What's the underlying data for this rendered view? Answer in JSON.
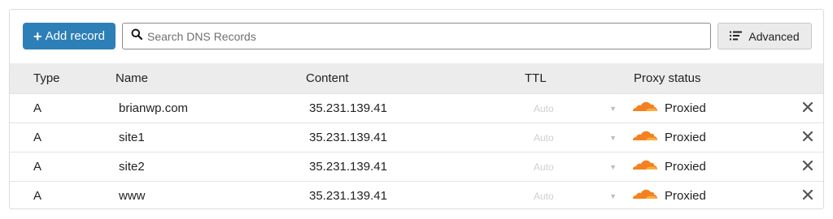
{
  "toolbar": {
    "add_label": "Add record",
    "search_placeholder": "Search DNS Records",
    "advanced_label": "Advanced"
  },
  "table": {
    "columns": [
      "Type",
      "Name",
      "Content",
      "TTL",
      "Proxy status"
    ],
    "rows": [
      {
        "type": "A",
        "name": "brianwp.com",
        "content": "35.231.139.41",
        "ttl": "Auto",
        "proxy": "Proxied"
      },
      {
        "type": "A",
        "name": "site1",
        "content": "35.231.139.41",
        "ttl": "Auto",
        "proxy": "Proxied"
      },
      {
        "type": "A",
        "name": "site2",
        "content": "35.231.139.41",
        "ttl": "Auto",
        "proxy": "Proxied"
      },
      {
        "type": "A",
        "name": "www",
        "content": "35.231.139.41",
        "ttl": "Auto",
        "proxy": "Proxied"
      }
    ]
  },
  "icons": {
    "search": "search-icon",
    "advanced": "list-icon",
    "proxy": "cloud-icon",
    "delete": "close-icon",
    "dropdown": "chevron-down-icon"
  },
  "colors": {
    "primary_button": "#2d7fb8",
    "cloud_orange": "#f48120",
    "header_bg": "#ececec",
    "advanced_bg": "#ebebeb"
  }
}
